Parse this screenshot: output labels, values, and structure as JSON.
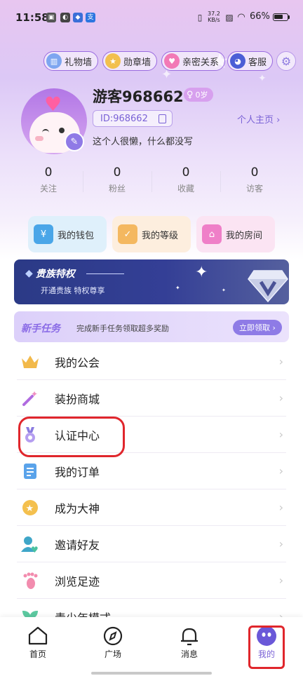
{
  "status_bar": {
    "time": "11:58",
    "speed_value": "37.2",
    "speed_unit": "KB/s",
    "battery": "66%"
  },
  "top_pills": [
    {
      "label": "礼物墙",
      "icon": "gift-wall-icon"
    },
    {
      "label": "勋章墙",
      "icon": "medal-wall-icon"
    },
    {
      "label": "亲密关系",
      "icon": "heart-icon"
    },
    {
      "label": "客服",
      "icon": "customer-service-icon"
    }
  ],
  "profile": {
    "nickname": "游客968662",
    "gender_age": "0岁",
    "id_label": "ID:968662",
    "homepage_link": "个人主页 ›",
    "bio": "这个人很懒，什么都没写"
  },
  "stats": [
    {
      "value": "0",
      "label": "关注"
    },
    {
      "value": "0",
      "label": "粉丝"
    },
    {
      "value": "0",
      "label": "收藏"
    },
    {
      "value": "0",
      "label": "访客"
    }
  ],
  "quick_cards": [
    {
      "label": "我的钱包",
      "icon": "wallet-icon",
      "color": "#dff0fb"
    },
    {
      "label": "我的等级",
      "icon": "level-icon",
      "color": "#fdeede"
    },
    {
      "label": "我的房间",
      "icon": "room-icon",
      "color": "#fbe4f3"
    }
  ],
  "noble_banner": {
    "title": "贵族特权",
    "subtitle": "开通贵族 特权尊享"
  },
  "newbie_banner": {
    "title": "新手任务",
    "description": "完成新手任务领取超多奖励",
    "button": "立即领取 ›"
  },
  "menu": [
    {
      "label": "我的公会",
      "icon": "crown-icon"
    },
    {
      "label": "装扮商城",
      "icon": "magic-wand-icon"
    },
    {
      "label": "认证中心",
      "icon": "medal-icon"
    },
    {
      "label": "我的订单",
      "icon": "order-list-icon"
    },
    {
      "label": "成为大神",
      "icon": "star-badge-icon"
    },
    {
      "label": "邀请好友",
      "icon": "invite-friend-icon"
    },
    {
      "label": "浏览足迹",
      "icon": "footprint-icon"
    },
    {
      "label": "青少年模式",
      "icon": "sprout-icon"
    }
  ],
  "tabbar": [
    {
      "label": "首页",
      "icon": "home-icon"
    },
    {
      "label": "广场",
      "icon": "compass-icon"
    },
    {
      "label": "消息",
      "icon": "bell-icon"
    },
    {
      "label": "我的",
      "icon": "profile-avatar-icon"
    }
  ],
  "colors": {
    "accent": "#7a62d6",
    "highlight": "#e0262c"
  }
}
